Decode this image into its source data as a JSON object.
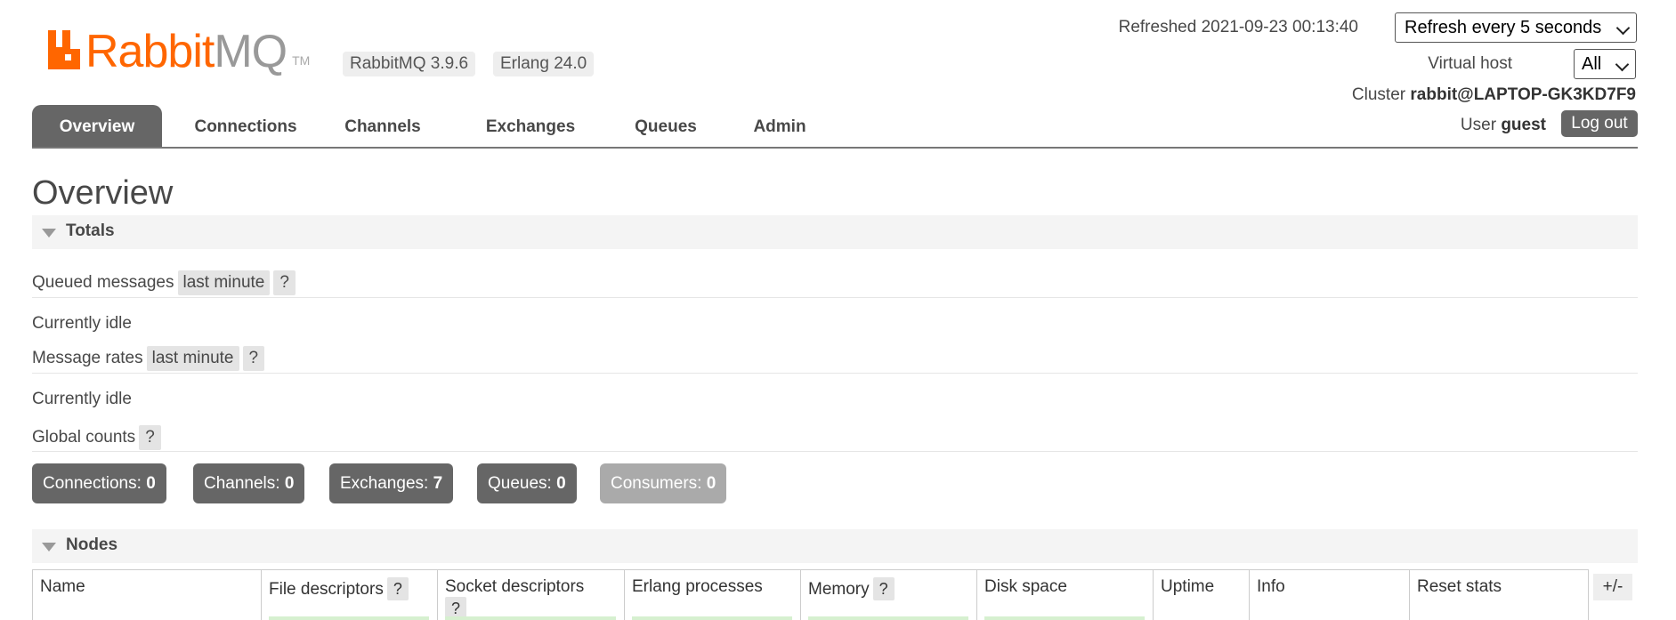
{
  "brand": {
    "name_part1": "Rabbit",
    "name_part2": "MQ",
    "trademark": "TM",
    "colors": {
      "orange": "#ff6600",
      "grey": "#999999"
    }
  },
  "versions": {
    "rabbitmq": "RabbitMQ 3.9.6",
    "erlang": "Erlang 24.0"
  },
  "header": {
    "refreshed_label": "Refreshed",
    "refreshed_time": "2021-09-23 00:13:40",
    "refresh_select": "Refresh every 5 seconds",
    "vhost_label": "Virtual host",
    "vhost_select": "All",
    "cluster_label": "Cluster",
    "cluster_name": "rabbit@LAPTOP-GK3KD7F9",
    "user_label": "User",
    "user_name": "guest",
    "logout": "Log out"
  },
  "tabs": [
    {
      "label": "Overview",
      "active": true
    },
    {
      "label": "Connections"
    },
    {
      "label": "Channels"
    },
    {
      "label": "Exchanges"
    },
    {
      "label": "Queues"
    },
    {
      "label": "Admin"
    }
  ],
  "page_title": "Overview",
  "totals": {
    "title": "Totals",
    "queued_messages": {
      "label": "Queued messages",
      "range": "last minute",
      "help": "?",
      "status": "Currently idle"
    },
    "message_rates": {
      "label": "Message rates",
      "range": "last minute",
      "help": "?",
      "status": "Currently idle"
    },
    "global_counts": {
      "label": "Global counts",
      "help": "?"
    },
    "counts": [
      {
        "label": "Connections:",
        "value": "0"
      },
      {
        "label": "Channels:",
        "value": "0"
      },
      {
        "label": "Exchanges:",
        "value": "7"
      },
      {
        "label": "Queues:",
        "value": "0"
      },
      {
        "label": "Consumers:",
        "value": "0"
      }
    ]
  },
  "nodes": {
    "title": "Nodes",
    "columns": [
      "Name",
      "File descriptors",
      "Socket descriptors",
      "Erlang processes",
      "Memory",
      "Disk space",
      "Uptime",
      "Info",
      "Reset stats"
    ],
    "help": "?",
    "toggle": "+/-"
  }
}
